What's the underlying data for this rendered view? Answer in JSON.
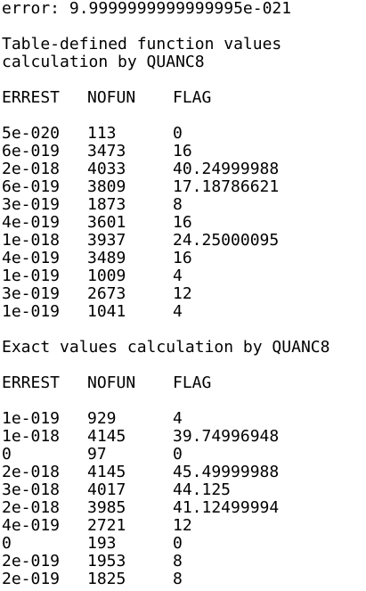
{
  "error_line": "error: 9.9999999999999995e-021",
  "section1": {
    "title_line1": "Table-defined function values",
    "title_line2": "calculation by QUANC8",
    "headers": [
      "ERREST",
      "NOFUN",
      "FLAG"
    ],
    "rows": [
      [
        "5e-020",
        "113",
        "0"
      ],
      [
        "6e-019",
        "3473",
        "16"
      ],
      [
        "2e-018",
        "4033",
        "40.24999988"
      ],
      [
        "6e-019",
        "3809",
        "17.18786621"
      ],
      [
        "3e-019",
        "1873",
        "8"
      ],
      [
        "4e-019",
        "3601",
        "16"
      ],
      [
        "1e-018",
        "3937",
        "24.25000095"
      ],
      [
        "4e-019",
        "3489",
        "16"
      ],
      [
        "1e-019",
        "1009",
        "4"
      ],
      [
        "3e-019",
        "2673",
        "12"
      ],
      [
        "1e-019",
        "1041",
        "4"
      ]
    ]
  },
  "section2": {
    "title": "Exact values calculation by QUANC8",
    "headers": [
      "ERREST",
      "NOFUN",
      "FLAG"
    ],
    "rows": [
      [
        "1e-019",
        "929",
        "4"
      ],
      [
        "1e-018",
        "4145",
        "39.74996948"
      ],
      [
        "0",
        "97",
        "0"
      ],
      [
        "2e-018",
        "4145",
        "45.49999988"
      ],
      [
        "3e-018",
        "4017",
        "44.125"
      ],
      [
        "2e-018",
        "3985",
        "41.12499994"
      ],
      [
        "4e-019",
        "2721",
        "12"
      ],
      [
        "0",
        "193",
        "0"
      ],
      [
        "2e-019",
        "1953",
        "8"
      ],
      [
        "2e-019",
        "1825",
        "8"
      ]
    ]
  }
}
